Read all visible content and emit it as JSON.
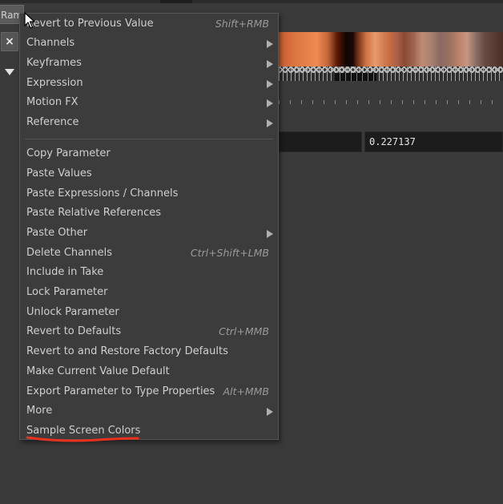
{
  "tab": {
    "label": "Ram"
  },
  "close_button": {
    "label": "×"
  },
  "value_field": {
    "value": "0.227137"
  },
  "context_menu": {
    "items": [
      {
        "label": "Revert to Previous Value",
        "shortcut": "Shift+RMB"
      },
      {
        "label": "Channels",
        "submenu": true
      },
      {
        "label": "Keyframes",
        "submenu": true
      },
      {
        "label": "Expression",
        "submenu": true
      },
      {
        "label": "Motion FX",
        "submenu": true
      },
      {
        "label": "Reference",
        "submenu": true
      },
      {
        "label": "Copy Parameter"
      },
      {
        "label": "Paste Values"
      },
      {
        "label": "Paste Expressions / Channels"
      },
      {
        "label": "Paste Relative References"
      },
      {
        "label": "Paste Other",
        "submenu": true
      },
      {
        "label": "Delete Channels",
        "shortcut": "Ctrl+Shift+LMB"
      },
      {
        "label": "Include in Take"
      },
      {
        "label": "Lock Parameter"
      },
      {
        "label": "Unlock Parameter"
      },
      {
        "label": "Revert to Defaults",
        "shortcut": "Ctrl+MMB"
      },
      {
        "label": "Revert to and Restore Factory Defaults"
      },
      {
        "label": "Make Current Value Default"
      },
      {
        "label": "Export Parameter to Type Properties",
        "shortcut": "Alt+MMB"
      },
      {
        "label": "More",
        "submenu": true
      },
      {
        "label": "Sample Screen Colors",
        "highlighted_annotation": true
      }
    ]
  },
  "colors": {
    "background": "#3a3a3a",
    "menu_background": "#3c3c3c",
    "annotation": "#e8321e"
  }
}
